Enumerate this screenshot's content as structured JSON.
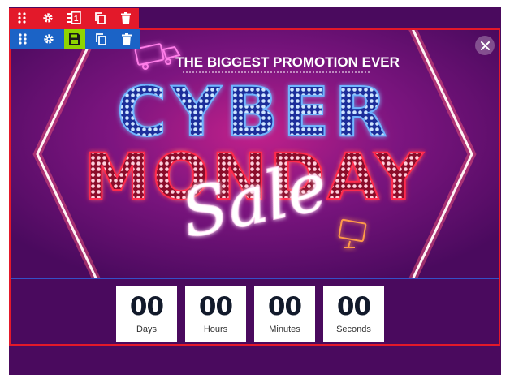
{
  "banner": {
    "tagline": "THE BIGGEST PROMOTION EVER",
    "headline_line1": "CYBER",
    "headline_line2": "MONDAY",
    "script_word": "Sale",
    "colors": {
      "background": "#4a0a5e",
      "neon_blue": "#4fa3ff",
      "neon_red": "#ff2a4d",
      "neon_pink": "#ff7de9",
      "neon_orange": "#ff9a4a"
    }
  },
  "countdown": {
    "units": [
      {
        "value": "00",
        "label": "Days"
      },
      {
        "value": "00",
        "label": "Hours"
      },
      {
        "value": "00",
        "label": "Minutes"
      },
      {
        "value": "00",
        "label": "Seconds"
      }
    ]
  },
  "toolbars": {
    "section": {
      "icons": [
        "drag-handle-icon",
        "gear-icon",
        "page-one-icon",
        "copy-icon",
        "trash-icon"
      ]
    },
    "element": {
      "icons": [
        "drag-handle-icon",
        "gear-icon",
        "save-icon",
        "copy-icon",
        "trash-icon"
      ]
    }
  },
  "close_icon": "close-icon"
}
